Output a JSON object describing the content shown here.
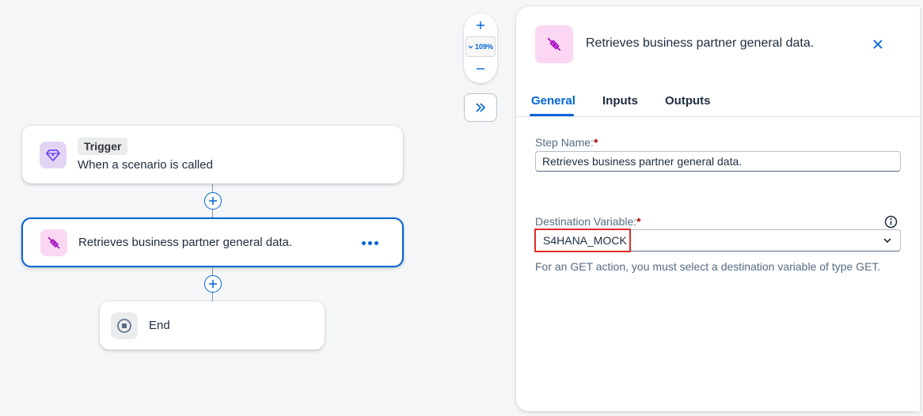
{
  "canvas": {
    "trigger": {
      "tag": "Trigger",
      "description": "When a scenario is called"
    },
    "action": {
      "label": "Retrieves business partner general data."
    },
    "end": {
      "label": "End"
    },
    "zoom": {
      "level": "109%"
    }
  },
  "panel": {
    "title": "Retrieves business partner general data.",
    "tabs": [
      {
        "label": "General"
      },
      {
        "label": "Inputs"
      },
      {
        "label": "Outputs"
      }
    ],
    "step_name": {
      "label": "Step Name:",
      "required": "*",
      "value": "Retrieves business partner general data."
    },
    "destination": {
      "label": "Destination Variable:",
      "required": "*",
      "value": "S4HANA_MOCK",
      "hint": "For an GET action, you must select a destination variable of type GET."
    }
  },
  "colors": {
    "accent": "#0064d9",
    "highlight": "#e32a2a",
    "trigger_bg": "#e2d5f4",
    "action_bg": "#fbd7f4"
  }
}
